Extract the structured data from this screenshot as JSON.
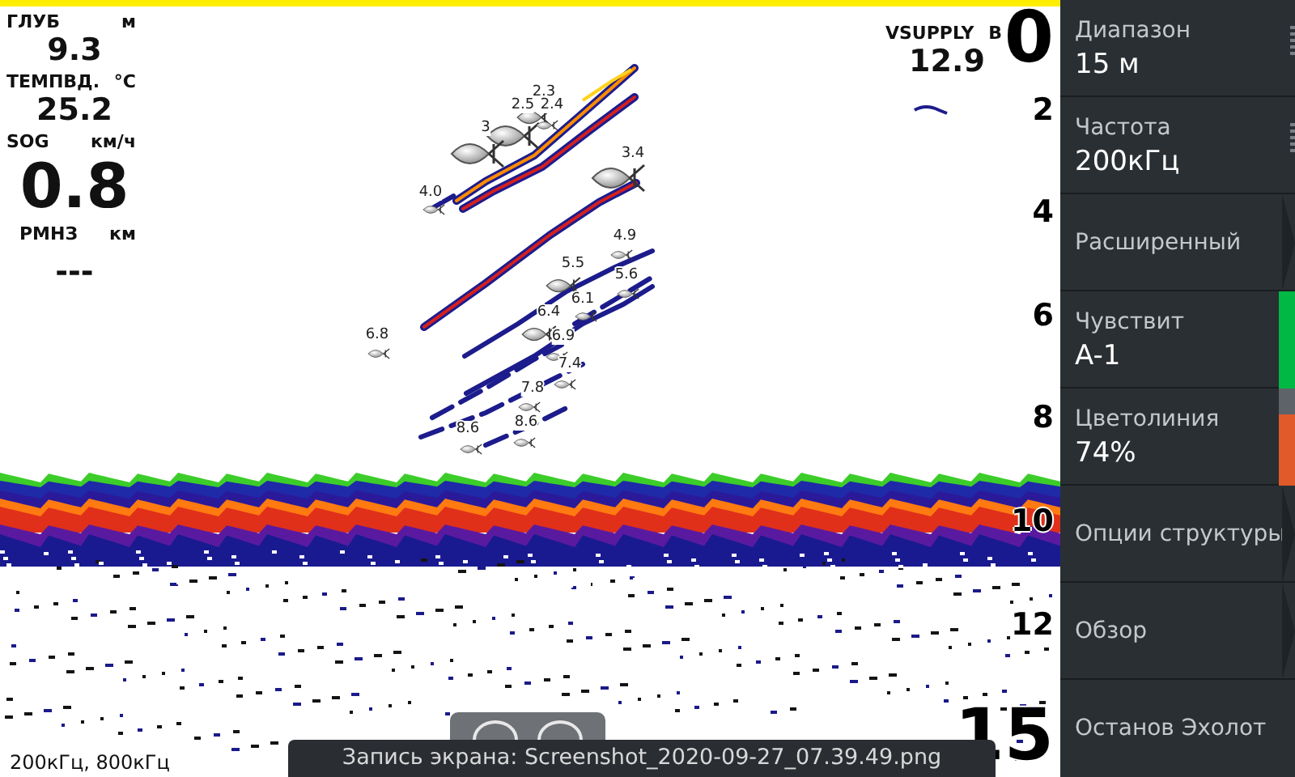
{
  "readouts": [
    {
      "label": "ГЛУБ",
      "unit": "м",
      "value": "9.3",
      "kind": "medium"
    },
    {
      "label": "ТЕМПВД.",
      "unit": "°C",
      "value": "25.2",
      "kind": "medium"
    },
    {
      "label": "SOG",
      "unit": "км/ч",
      "value": "0.8",
      "kind": "large"
    },
    {
      "label": "РМНЗ",
      "unit": "км",
      "value": "---",
      "kind": "medium"
    }
  ],
  "supply": {
    "label": "VSUPPLY",
    "unit": "В",
    "value": "12.9"
  },
  "depth_scale": [
    {
      "text": "0",
      "kind": "large"
    },
    {
      "text": "2",
      "kind": "small"
    },
    {
      "text": "4",
      "kind": "small"
    },
    {
      "text": "6",
      "kind": "small"
    },
    {
      "text": "8",
      "kind": "small"
    },
    {
      "text": "10",
      "kind": "small"
    },
    {
      "text": "12",
      "kind": "small"
    },
    {
      "text": "15",
      "kind": "large"
    }
  ],
  "fish": [
    {
      "label": "2.3",
      "kind": "medium"
    },
    {
      "label": "2.5",
      "kind": "large"
    },
    {
      "label": "2.4",
      "kind": "small"
    },
    {
      "label": "3",
      "kind": "large"
    },
    {
      "label": "3.4",
      "kind": "large"
    },
    {
      "label": "4.0",
      "kind": "small"
    },
    {
      "label": "4.9",
      "kind": "small"
    },
    {
      "label": "5.5",
      "kind": "medium"
    },
    {
      "label": "5.6",
      "kind": "small"
    },
    {
      "label": "6.1",
      "kind": "small"
    },
    {
      "label": "6.4",
      "kind": "medium"
    },
    {
      "label": "6.9",
      "kind": "small"
    },
    {
      "label": "6.8",
      "kind": "small"
    },
    {
      "label": "7.4",
      "kind": "small"
    },
    {
      "label": "7.8",
      "kind": "small"
    },
    {
      "label": "8.6",
      "kind": "small"
    },
    {
      "label": "8.6",
      "kind": "small"
    }
  ],
  "frequency_info": "200кГц, 800кГц",
  "toast": "Запись экрана: Screenshot_2020-09-27_07.39.49.png",
  "menu": [
    {
      "kind": "value",
      "label": "Диапазон",
      "value": "15 м"
    },
    {
      "kind": "value",
      "label": "Частота",
      "value": "200кГц"
    },
    {
      "kind": "submenu",
      "label": "Расширенный"
    },
    {
      "kind": "slider",
      "label": "Чувствит",
      "value": "A-1",
      "level": 1,
      "color": "#00b843"
    },
    {
      "kind": "slider",
      "label": "Цветолиния",
      "value": "74%",
      "level": 0.74,
      "color": "#e05a2a"
    },
    {
      "kind": "submenu",
      "label": "Опции структуры"
    },
    {
      "kind": "submenu",
      "label": "Обзор"
    },
    {
      "kind": "action",
      "label": "Останов Эхолот"
    }
  ]
}
